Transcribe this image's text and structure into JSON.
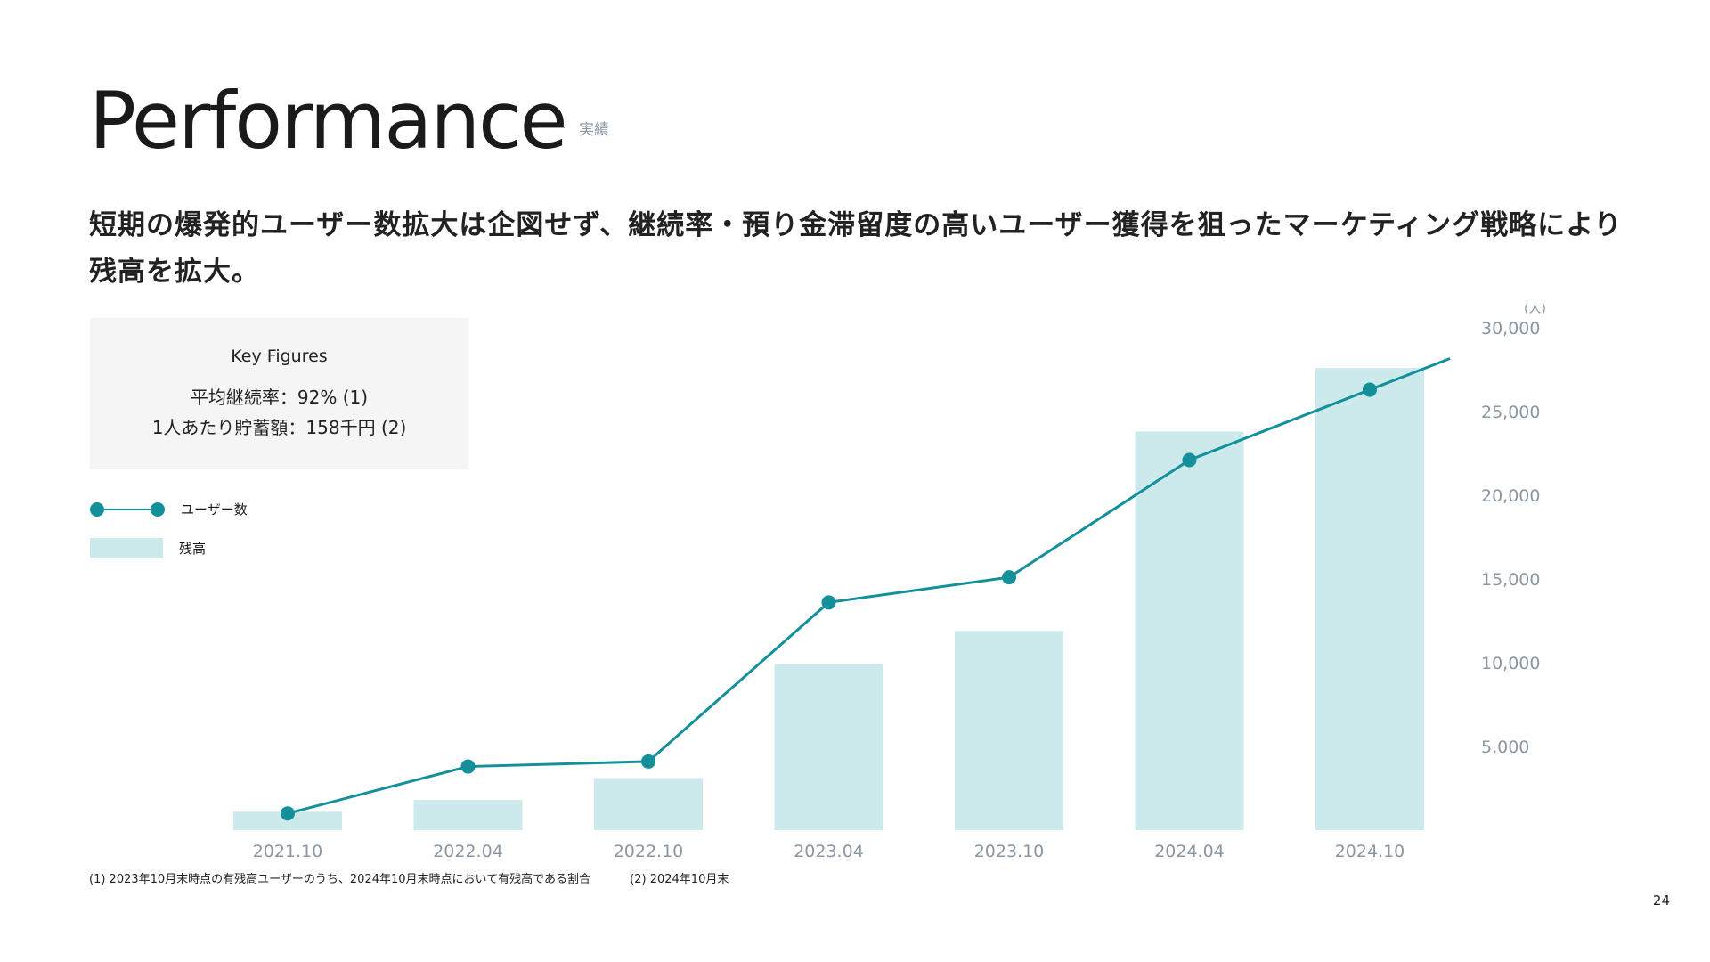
{
  "header": {
    "title": "Performance",
    "subtitle": "実績"
  },
  "lead": "短期の爆発的ユーザー数拡大は企図せず、継続率・預り金滞留度の高いユーザー獲得を狙ったマーケティング戦略により残高を拡大。",
  "key_figures": {
    "title": "Key Figures",
    "line1": "平均継続率：92% (1)",
    "line2": "1人あたり貯蓄額：158千円 (2)"
  },
  "legend": {
    "line_label": "ユーザー数",
    "bar_label": "残高"
  },
  "colors": {
    "line": "#14909b",
    "bar": "#cce9ec",
    "axis_text": "#8a97a3"
  },
  "chart_data": {
    "type": "bar",
    "categories": [
      "2021.10",
      "2022.04",
      "2022.10",
      "2023.04",
      "2023.10",
      "2024.04",
      "2024.10"
    ],
    "series": [
      {
        "name": "残高",
        "type": "bar",
        "values": [
          1100,
          1800,
          3100,
          9900,
          11900,
          23800,
          27600
        ]
      },
      {
        "name": "ユーザー数",
        "type": "line",
        "values": [
          1000,
          3800,
          4100,
          13600,
          15100,
          22100,
          26300
        ]
      }
    ],
    "yaxis": {
      "unit": "(人)",
      "ticks": [
        "5,000",
        "10,000",
        "15,000",
        "20,000",
        "25,000",
        "30,000"
      ],
      "ylim": [
        0,
        30000
      ]
    }
  },
  "footnotes": {
    "note1": "(1) 2023年10月末時点の有残高ユーザーのうち、2024年10月末時点において有残高である割合",
    "note2": "(2) 2024年10月末"
  },
  "page_number": "24"
}
